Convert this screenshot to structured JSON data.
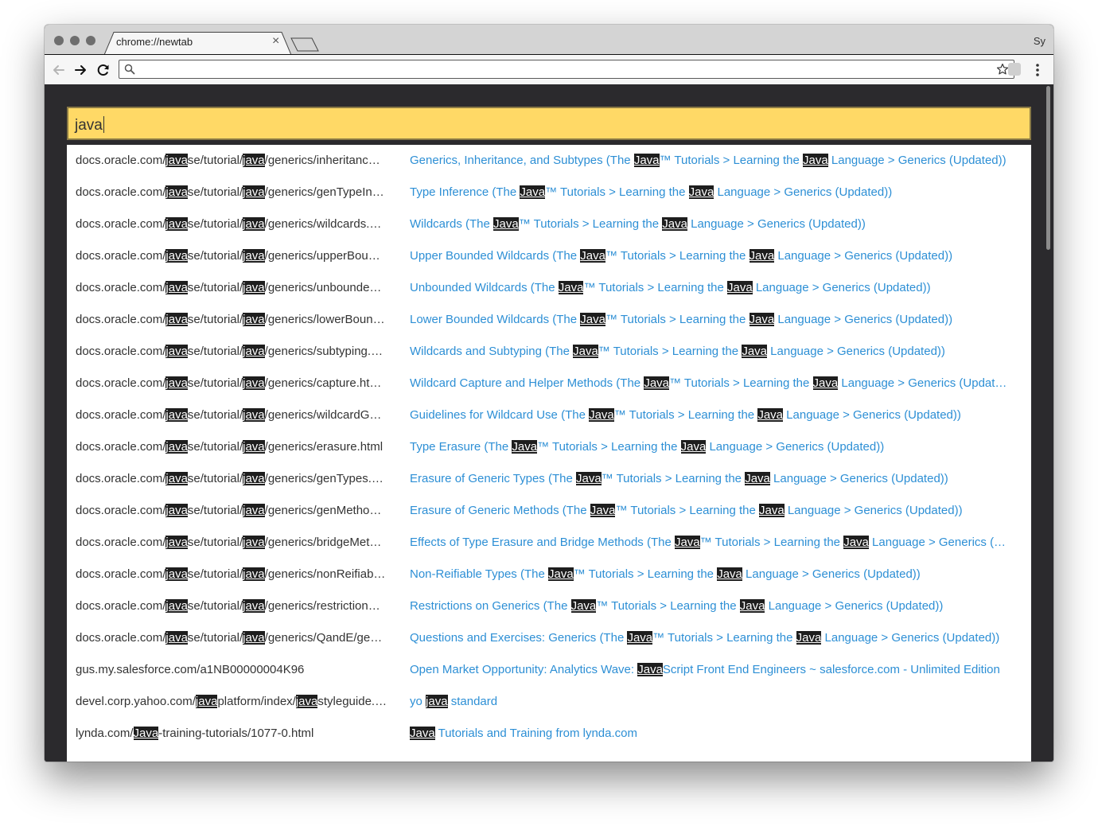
{
  "tab": {
    "title": "chrome://newtab",
    "close_glyph": "×"
  },
  "profile_label": "Sy",
  "omnibox": {
    "value": ""
  },
  "search": {
    "query": "java"
  },
  "results": [
    {
      "url": "docs.oracle.com/javase/tutorial/java/generics/inheritanc…",
      "title": "Generics, Inheritance, and Subtypes (The Java™ Tutorials > Learning the Java Language > Generics (Updated))"
    },
    {
      "url": "docs.oracle.com/javase/tutorial/java/generics/genTypeIn…",
      "title": "Type Inference (The Java™ Tutorials > Learning the Java Language > Generics (Updated))"
    },
    {
      "url": "docs.oracle.com/javase/tutorial/java/generics/wildcards.…",
      "title": "Wildcards (The Java™ Tutorials > Learning the Java Language > Generics (Updated))"
    },
    {
      "url": "docs.oracle.com/javase/tutorial/java/generics/upperBou…",
      "title": "Upper Bounded Wildcards (The Java™ Tutorials > Learning the Java Language > Generics (Updated))"
    },
    {
      "url": "docs.oracle.com/javase/tutorial/java/generics/unbounde…",
      "title": "Unbounded Wildcards (The Java™ Tutorials > Learning the Java Language > Generics (Updated))"
    },
    {
      "url": "docs.oracle.com/javase/tutorial/java/generics/lowerBoun…",
      "title": "Lower Bounded Wildcards (The Java™ Tutorials > Learning the Java Language > Generics (Updated))"
    },
    {
      "url": "docs.oracle.com/javase/tutorial/java/generics/subtyping.…",
      "title": "Wildcards and Subtyping (The Java™ Tutorials > Learning the Java Language > Generics (Updated))"
    },
    {
      "url": "docs.oracle.com/javase/tutorial/java/generics/capture.ht…",
      "title": "Wildcard Capture and Helper Methods (The Java™ Tutorials > Learning the Java Language > Generics (Updat…"
    },
    {
      "url": "docs.oracle.com/javase/tutorial/java/generics/wildcardG…",
      "title": "Guidelines for Wildcard Use (The Java™ Tutorials > Learning the Java Language > Generics (Updated))"
    },
    {
      "url": "docs.oracle.com/javase/tutorial/java/generics/erasure.html",
      "title": "Type Erasure (The Java™ Tutorials > Learning the Java Language > Generics (Updated))"
    },
    {
      "url": "docs.oracle.com/javase/tutorial/java/generics/genTypes.…",
      "title": "Erasure of Generic Types (The Java™ Tutorials > Learning the Java Language > Generics (Updated))"
    },
    {
      "url": "docs.oracle.com/javase/tutorial/java/generics/genMetho…",
      "title": "Erasure of Generic Methods (The Java™ Tutorials > Learning the Java Language > Generics (Updated))"
    },
    {
      "url": "docs.oracle.com/javase/tutorial/java/generics/bridgeMet…",
      "title": "Effects of Type Erasure and Bridge Methods (The Java™ Tutorials > Learning the Java Language > Generics (…"
    },
    {
      "url": "docs.oracle.com/javase/tutorial/java/generics/nonReifiab…",
      "title": "Non-Reifiable Types (The Java™ Tutorials > Learning the Java Language > Generics (Updated))"
    },
    {
      "url": "docs.oracle.com/javase/tutorial/java/generics/restriction…",
      "title": "Restrictions on Generics (The Java™ Tutorials > Learning the Java Language > Generics (Updated))"
    },
    {
      "url": "docs.oracle.com/javase/tutorial/java/generics/QandE/ge…",
      "title": "Questions and Exercises: Generics (The Java™ Tutorials > Learning the Java Language > Generics (Updated))"
    },
    {
      "url": "gus.my.salesforce.com/a1NB00000004K96",
      "title": "Open Market Opportunity: Analytics Wave: JavaScript Front End Engineers ~ salesforce.com - Unlimited Edition"
    },
    {
      "url": "devel.corp.yahoo.com/javaplatform/index/javastyleguide.…",
      "title": "yo java standard"
    },
    {
      "url": "lynda.com/Java-training-tutorials/1077-0.html",
      "title": "Java Tutorials and Training from lynda.com"
    }
  ],
  "colors": {
    "query_bar": "#ffd966",
    "result_title": "#2d8fd5",
    "result_url": "#333333",
    "highlight_bg": "#1e1e1e",
    "page_bg": "#2b2a2d"
  },
  "icons": [
    "back-arrow-icon",
    "forward-arrow-icon",
    "reload-icon",
    "search-icon",
    "bookmark-star-icon",
    "extension-icon",
    "menu-icon",
    "close-icon",
    "new-tab-icon"
  ]
}
